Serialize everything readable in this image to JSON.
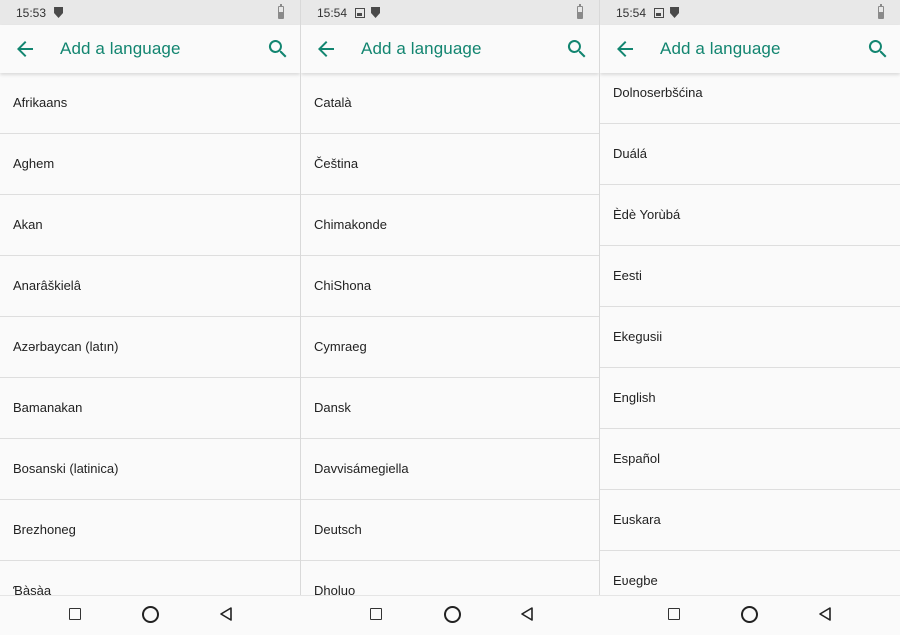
{
  "app_title": "Add a language",
  "accent_color": "#128570",
  "icons": {
    "back": "arrow-left-icon",
    "search": "search-icon",
    "shield": "shield-icon",
    "image": "image-icon",
    "battery": "battery-icon"
  },
  "screens": [
    {
      "time": "15:53",
      "status_icons": [
        "shield-icon"
      ],
      "items": [
        "Afrikaans",
        "Aghem",
        "Akan",
        "Anarâškielâ",
        "Azərbaycan (latın)",
        "Bamanakan",
        "Bosanski (latinica)",
        "Brezhoneg",
        "Ɓàsàa"
      ]
    },
    {
      "time": "15:54",
      "status_icons": [
        "image-icon",
        "shield-icon"
      ],
      "items": [
        "Català",
        "Čeština",
        "Chimakonde",
        "ChiShona",
        "Cymraeg",
        "Dansk",
        "Davvisámegiella",
        "Deutsch",
        "Dholuo"
      ]
    },
    {
      "time": "15:54",
      "status_icons": [
        "image-icon",
        "shield-icon"
      ],
      "items": [
        "Dolnoserbšćina",
        "Duálá",
        "Èdè Yorùbá",
        "Eesti",
        "Ekegusii",
        "English",
        "Español",
        "Euskara",
        "Eʋegbe"
      ]
    }
  ],
  "navbar": [
    "recents-square-icon",
    "home-circle-icon",
    "back-triangle-icon"
  ]
}
